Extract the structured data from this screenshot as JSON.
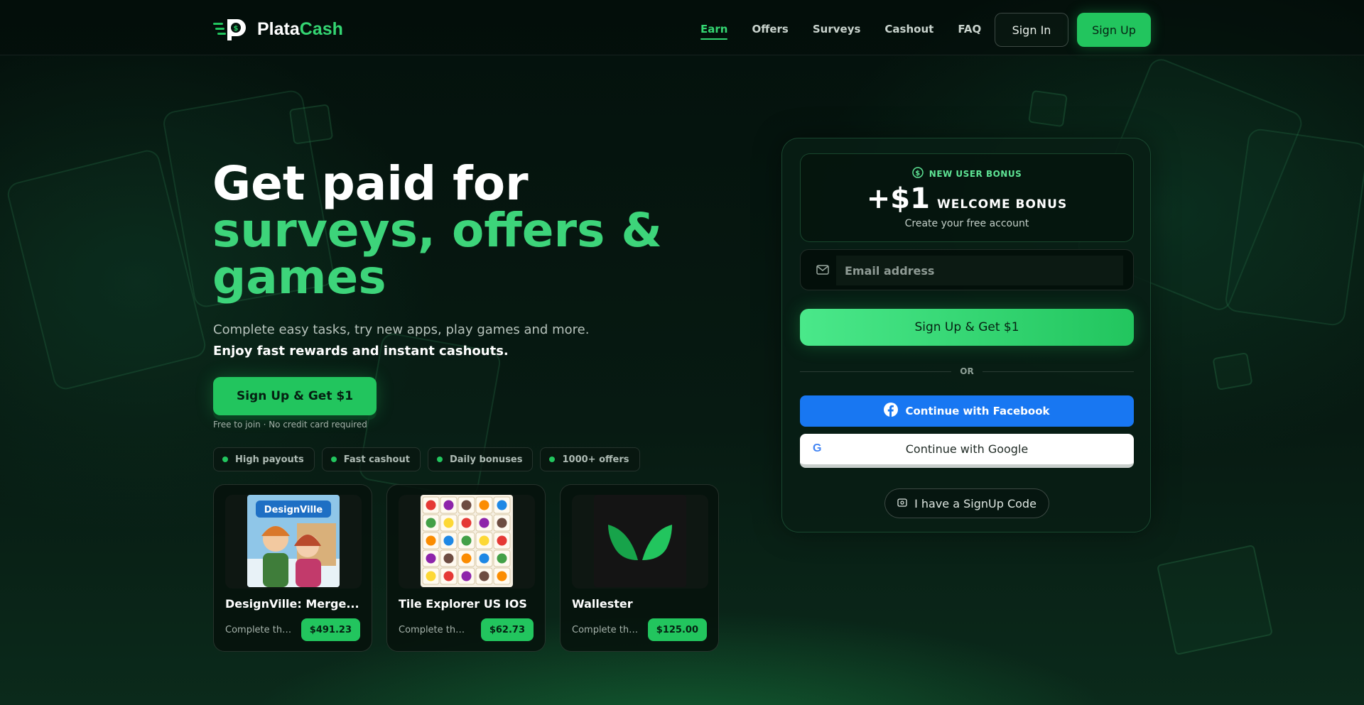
{
  "brand": {
    "name_part1": "Plata",
    "name_part2": "Cash"
  },
  "nav": {
    "items": [
      "Earn",
      "Offers",
      "Surveys",
      "Cashout",
      "FAQ"
    ],
    "active": "Earn",
    "sign_in": "Sign In",
    "sign_up": "Sign Up"
  },
  "hero": {
    "title_line1": "Get paid for",
    "title_line2": "surveys, offers &",
    "title_line3": "games",
    "subtitle": "Complete easy tasks, try new apps, play games and more.",
    "subtitle_bold": "Enjoy fast rewards and instant cashouts.",
    "cta": "Sign Up & Get $1",
    "note": "Free to join · No credit card required"
  },
  "features": [
    "High payouts",
    "Fast cashout",
    "Daily bonuses",
    "1000+ offers"
  ],
  "offers": [
    {
      "name": "DesignVille: Merge...",
      "desc": "Complete the offer",
      "price": "$491.23",
      "icon": "designville-thumbnail"
    },
    {
      "name": "Tile Explorer US IOS",
      "desc": "Complete the offer",
      "price": "$62.73",
      "icon": "tile-explorer-thumbnail"
    },
    {
      "name": "Wallester",
      "desc": "Complete the offer",
      "price": "$125.00",
      "icon": "wallester-logo"
    }
  ],
  "panel": {
    "bonus_tag": "NEW USER BONUS",
    "bonus_amount": "+$1",
    "bonus_label": "WELCOME BONUS",
    "bonus_sub": "Create your free account",
    "email_placeholder": "Email address",
    "cta": "Sign Up & Get $1",
    "or": "OR",
    "facebook": "Continue with Facebook",
    "google": "Continue with Google",
    "google_glyph": "G",
    "code": "I have a SignUp Code"
  },
  "colors": {
    "accent": "#22c55e",
    "accent_light": "#3dd47a",
    "facebook": "#1877f2",
    "background": "#06140e"
  }
}
